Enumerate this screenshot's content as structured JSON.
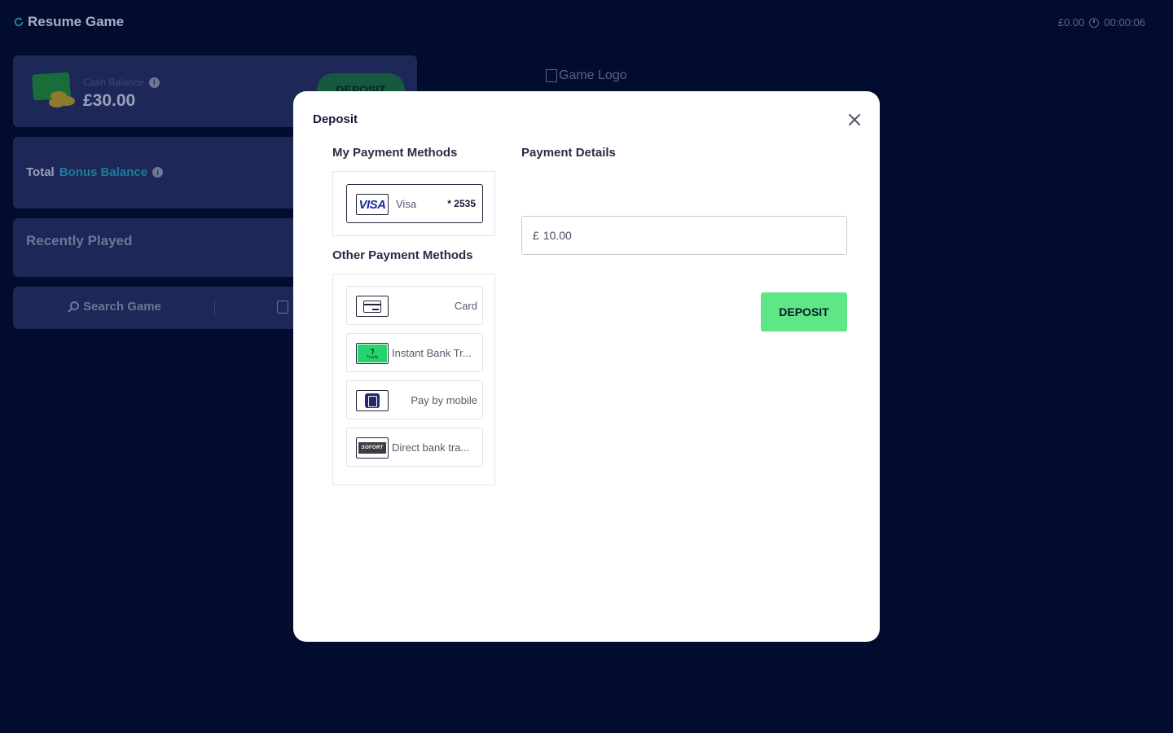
{
  "background": {
    "resume_label": "Resume Game",
    "top_balance": "£0.00",
    "top_timer": "00:00:06",
    "cash_balance_label": "Cash Balance",
    "cash_balance_value": "£30.00",
    "deposit_button_label": "DEPOSIT",
    "bonus_prefix": "Total",
    "bonus_accent": "Bonus Balance",
    "recently_played_title": "Recently Played",
    "search_game_label": "Search Game",
    "game_logo_alt": "Game Logo"
  },
  "modal": {
    "title": "Deposit",
    "my_methods_title": "My Payment Methods",
    "other_methods_title": "Other Payment Methods",
    "payment_details_title": "Payment Details",
    "saved_methods": [
      {
        "label": "Visa",
        "suffix": "* 2535",
        "icon": "visa-icon"
      }
    ],
    "other_methods": [
      {
        "label": "Card",
        "icon": "card-icon"
      },
      {
        "label": "Instant Bank Tr...",
        "icon": "trustly-icon"
      },
      {
        "label": "Pay by mobile",
        "icon": "mobile-pay-icon"
      },
      {
        "label": "Direct bank tra...",
        "icon": "sofort-icon"
      }
    ],
    "amount_currency": "£",
    "amount_value": "10.00",
    "deposit_button_label": "DEPOSIT",
    "visa_mark": "VISA",
    "trustly_mark": "Trustly",
    "sofort_mark": "SOFORT"
  },
  "colors": {
    "page_background": "#020c2e",
    "deposit_button": "#5ee687",
    "bonus_accent": "#1f7d9c",
    "visa_blue": "#1a2c9c"
  }
}
